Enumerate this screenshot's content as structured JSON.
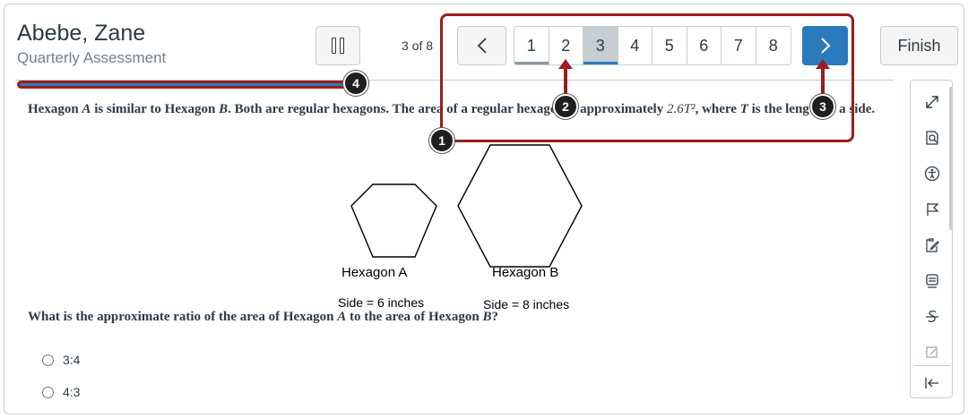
{
  "header": {
    "student_name": "Abebe, Zane",
    "assessment_name": "Quarterly Assessment",
    "counter": "3 of 8",
    "finish_label": "Finish"
  },
  "pager": {
    "pages": [
      "1",
      "2",
      "3",
      "4",
      "5",
      "6",
      "7",
      "8"
    ],
    "current": 3,
    "answered": [
      1
    ]
  },
  "progress": {
    "fraction": 0.39
  },
  "callouts": [
    "1",
    "2",
    "3",
    "4"
  ],
  "question": {
    "text_a": "Hexagon ",
    "var_a": "A",
    "text_b": " is similar to Hexagon ",
    "var_b": "B",
    "text_c": ". Both are regular hexagons. The area of a regular hexagon is approximately ",
    "formula": "2.6T²",
    "text_d": ", where ",
    "var_t": "T",
    "text_e": " is the length of a side."
  },
  "figure": {
    "hexagon_a": {
      "label": "Hexagon A",
      "side": "Side = 6 inches"
    },
    "hexagon_b": {
      "label": "Hexagon B",
      "side": "Side = 8 inches"
    }
  },
  "prompt": {
    "text_a": "What is the approximate ratio of the area of Hexagon ",
    "var_a": "A",
    "text_b": " to the area of Hexagon ",
    "var_b": "B",
    "text_c": "?"
  },
  "choices": [
    "3:4",
    "4:3"
  ],
  "toolbar": {
    "tools": [
      "expand-icon",
      "document-search-icon",
      "accessibility-icon",
      "flag-icon",
      "notepad-icon",
      "calculator-icon",
      "strikethrough-icon",
      "highlighter-icon",
      "collapse-icon"
    ]
  },
  "colors": {
    "accent": "#2b7abc",
    "callout": "#9b1d1d",
    "text": "#2d3b45"
  }
}
